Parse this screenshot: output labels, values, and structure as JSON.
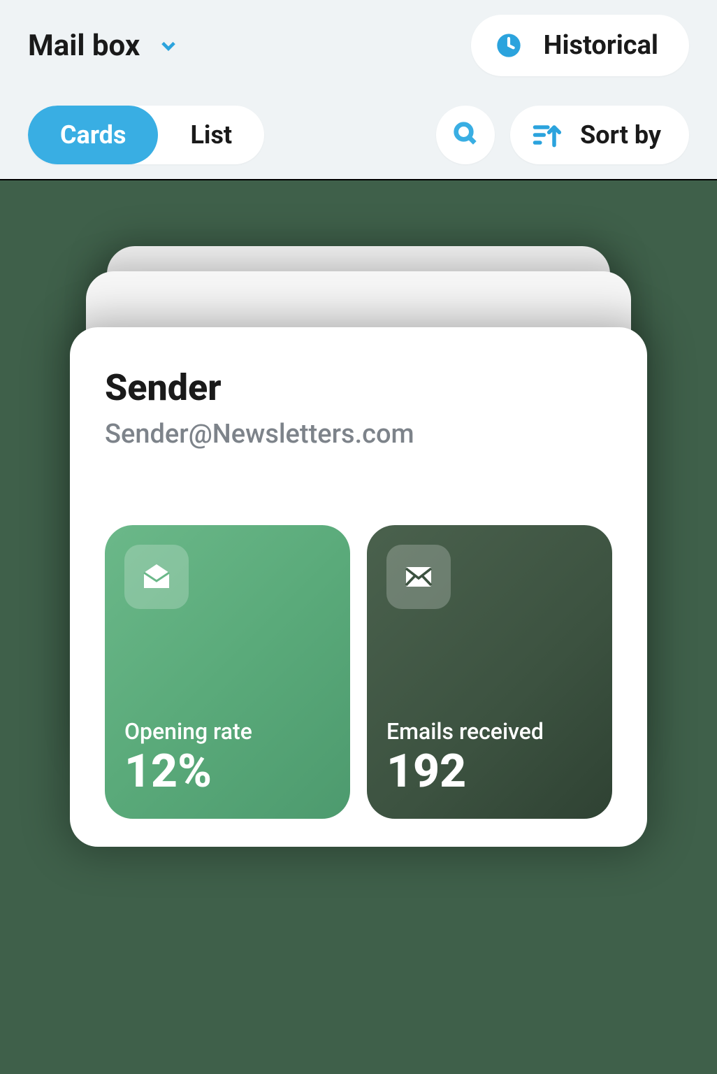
{
  "header": {
    "title": "Mail box",
    "historical_label": "Historical"
  },
  "view_toggle": {
    "cards_label": "Cards",
    "list_label": "List",
    "active": "cards"
  },
  "sort": {
    "label": "Sort by"
  },
  "card": {
    "title": "Sender",
    "email": "Sender@Newsletters.com",
    "metrics": [
      {
        "label": "Opening rate",
        "value": "12%"
      },
      {
        "label": "Emails received",
        "value": "192"
      }
    ]
  },
  "colors": {
    "accent": "#39aee3",
    "bg_dark": "#3f604a"
  }
}
